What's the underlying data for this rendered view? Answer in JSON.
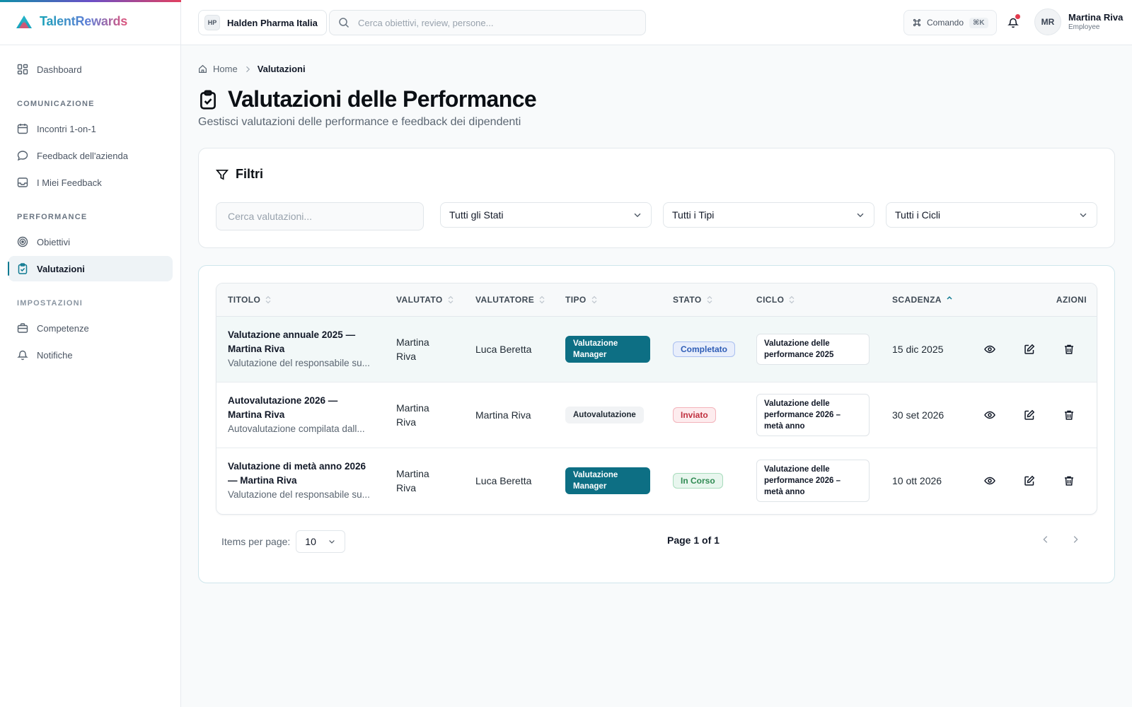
{
  "app": {
    "name": "TalentRewards"
  },
  "sidebar": {
    "items": [
      {
        "label": "Dashboard"
      },
      {
        "label": "Incontri 1-on-1"
      },
      {
        "label": "Feedback dell'azienda"
      },
      {
        "label": "I Miei Feedback"
      },
      {
        "label": "Obiettivi"
      },
      {
        "label": "Valutazioni"
      },
      {
        "label": "Competenze"
      },
      {
        "label": "Notifiche"
      }
    ],
    "sections": [
      "COMUNICAZIONE",
      "PERFORMANCE",
      "IMPOSTAZIONI"
    ]
  },
  "topbar": {
    "org_badge": "HP",
    "org_name": "Halden Pharma Italia",
    "search_placeholder": "Cerca obiettivi, review, persone...",
    "command_label": "Comando",
    "command_shortcut": "⌘K",
    "user_initials": "MR",
    "user_name": "Martina Riva",
    "user_role": "Employee"
  },
  "breadcrumb": {
    "home": "Home",
    "current": "Valutazioni"
  },
  "page": {
    "title": "Valutazioni delle Performance",
    "subtitle": "Gestisci valutazioni delle performance e feedback dei dipendenti"
  },
  "filters": {
    "title": "Filtri",
    "search_placeholder": "Cerca valutazioni...",
    "status": "Tutti gli Stati",
    "type": "Tutti i Tipi",
    "cycle": "Tutti i Cicli"
  },
  "table": {
    "headers": {
      "title": "TITOLO",
      "evaluated": "VALUTATO",
      "evaluator": "VALUTATORE",
      "type": "TIPO",
      "status": "STATO",
      "cycle": "CICLO",
      "deadline": "SCADENZA",
      "actions": "AZIONI"
    },
    "rows": [
      {
        "title": "Valutazione annuale 2025 — Martina Riva",
        "description": "Valutazione del responsabile su...",
        "evaluated": "Martina Riva",
        "evaluator": "Luca Beretta",
        "type": "Valutazione Manager",
        "status": "Completato",
        "cycle": "Valutazione delle performance 2025",
        "deadline": "15 dic 2025"
      },
      {
        "title": "Autovalutazione 2026 — Martina Riva",
        "description": "Autovalutazione compilata dall...",
        "evaluated": "Martina Riva",
        "evaluator": "Martina Riva",
        "type": "Autovalutazione",
        "status": "Inviato",
        "cycle": "Valutazione delle performance 2026 – metà anno",
        "deadline": "30 set 2026"
      },
      {
        "title": "Valutazione di metà anno 2026 — Martina Riva",
        "description": "Valutazione del responsabile su...",
        "evaluated": "Martina Riva",
        "evaluator": "Luca Beretta",
        "type": "Valutazione Manager",
        "status": "In Corso",
        "cycle": "Valutazione delle performance 2026 – metà anno",
        "deadline": "10 ott 2026"
      }
    ]
  },
  "pagination": {
    "items_per_page_label": "Items per page:",
    "items_per_page": "10",
    "page_info": "Page 1 of 1"
  },
  "colors": {
    "accent": "#0f7a91",
    "manager_chip": "#0d6f84",
    "status_done": "#2f5db6",
    "status_sent": "#c0303f",
    "status_progress": "#2f8a52",
    "notification_dot": "#e23b4e"
  }
}
